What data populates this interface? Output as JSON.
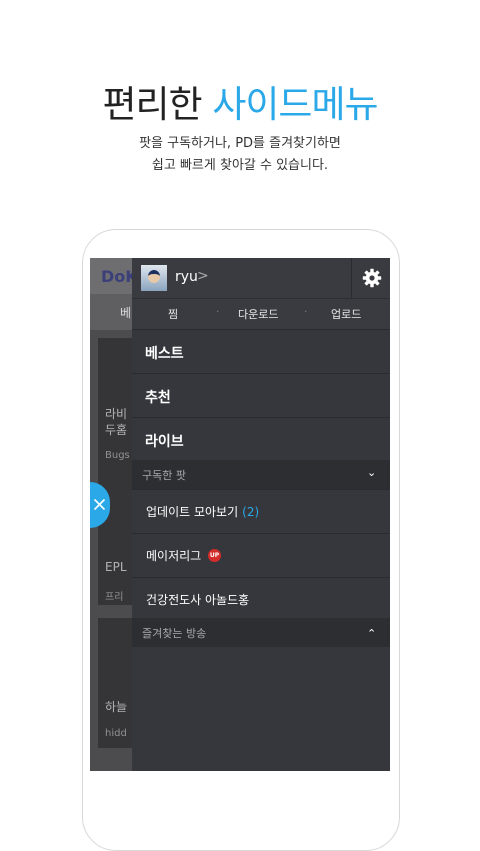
{
  "hero": {
    "title_main": "편리한 ",
    "title_accent": "사이드메뉴",
    "line1": "팟을 구독하거나, PD를 즐겨찾기하면",
    "line2": "쉽고 빠르게 찾아갈 수 있습니다.",
    "accent_color": "#2aa8e8"
  },
  "background_app": {
    "logo_text": "DoK",
    "tab_text": "베",
    "card1_title": "라비",
    "card1_title2": "두홈",
    "card1_sub": "Bugs",
    "card2_title": "EPL",
    "card2_sub": "프리",
    "card3_title": "하늘",
    "card3_sub": "hidd"
  },
  "menu": {
    "username": "ryu",
    "username_chevron": ">",
    "settings_icon": "gear-icon",
    "subnav": [
      "찜",
      "다운로드",
      "업로드"
    ],
    "main_items": [
      "베스트",
      "추천",
      "라이브"
    ],
    "subscribed_header": "구독한 팟",
    "subscribed_items": [
      {
        "label": "업데이트 모아보기",
        "count": "(2)"
      },
      {
        "label": "메이저리그",
        "badge": "UP"
      },
      {
        "label": "건강전도사 아놀드홍"
      }
    ],
    "favorites_header": "즐겨찾는 방송"
  },
  "close_icon": "close-icon"
}
